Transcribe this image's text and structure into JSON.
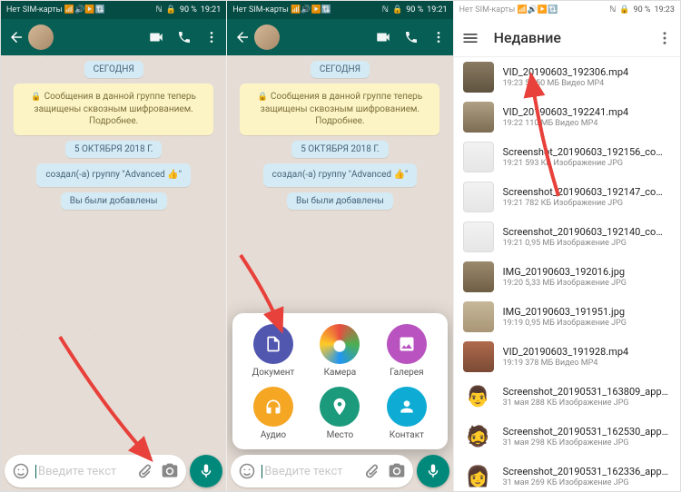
{
  "statusbar": {
    "sim": "Нет SIM-карты",
    "battery": "90 %",
    "time1": "19:21",
    "time2": "19:23"
  },
  "wa": {
    "today": "СЕГОДНЯ",
    "encryption": "Сообщения в данной группе теперь защищены сквозным шифрованием. Подробнее.",
    "date": "5 ОКТЯБРЯ 2018 Г.",
    "created": "создал(-а) группу \"Advanced 👍\"",
    "added": "Вы были добавлены",
    "placeholder": "Введите текст"
  },
  "attach": {
    "document": "Документ",
    "camera": "Камера",
    "gallery": "Галерея",
    "audio": "Аудио",
    "location": "Место",
    "contact": "Контакт"
  },
  "picker": {
    "title": "Недавние",
    "files": [
      {
        "name": "VID_20190603_192306.mp4",
        "meta": "19:23 54,50 МБ Видео MP4"
      },
      {
        "name": "VID_20190603_192241.mp4",
        "meta": "19:22 110 МБ Видео MP4"
      },
      {
        "name": "Screenshot_20190603_192156_com…",
        "meta": "19:21 593 КБ Изображение JPG"
      },
      {
        "name": "Screenshot_20190603_192147_com…",
        "meta": "19:21 782 КБ Изображение JPG"
      },
      {
        "name": "Screenshot_20190603_192140_com…",
        "meta": "19:21 0,95 МБ Изображение JPG"
      },
      {
        "name": "IMG_20190603_192016.jpg",
        "meta": "19:20 5,33 МБ Изображение JPG"
      },
      {
        "name": "IMG_20190603_191951.jpg",
        "meta": "19:19 0,95 МБ Изображение JPG"
      },
      {
        "name": "VID_20190603_191928.mp4",
        "meta": "19:19 378 МБ Видео MP4"
      },
      {
        "name": "Screenshot_20190531_163809_app…",
        "meta": "31 мая 288 КБ Изображение JPG"
      },
      {
        "name": "Screenshot_20190531_162530_app…",
        "meta": "31 мая 298 КБ Изображение JPG"
      },
      {
        "name": "Screenshot_20190531_162336_app…",
        "meta": "31 мая 269 КБ Изображение JPG"
      }
    ]
  }
}
